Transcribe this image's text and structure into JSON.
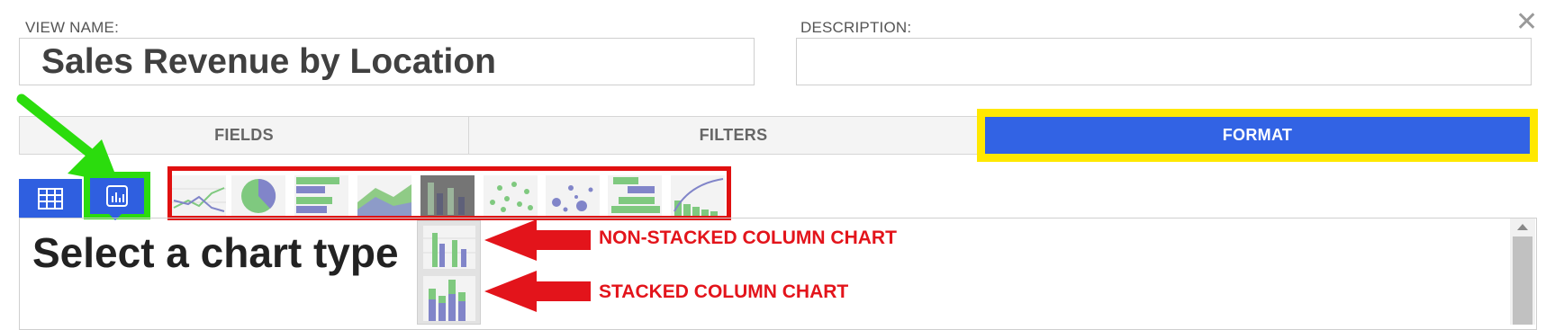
{
  "form": {
    "view_name_label": "VIEW NAME:",
    "view_name_value": "Sales Revenue by Location",
    "description_label": "DESCRIPTION:",
    "description_value": ""
  },
  "tabs": [
    {
      "label": "FIELDS"
    },
    {
      "label": "FILTERS"
    },
    {
      "label": "FORMAT"
    }
  ],
  "view_toggle": {
    "table_icon": "table-grid-icon",
    "chart_icon": "bar-chart-icon"
  },
  "chart_types": [
    "line",
    "pie",
    "horizontal-bar",
    "area",
    "column",
    "scatter",
    "bubble",
    "gantt",
    "pareto"
  ],
  "main": {
    "heading": "Select a chart type"
  },
  "column_options": [
    {
      "name": "non-stacked-column",
      "annotation": "NON-STACKED COLUMN CHART"
    },
    {
      "name": "stacked-column",
      "annotation": "STACKED COLUMN CHART"
    }
  ],
  "colors": {
    "accent_blue": "#3263e4",
    "highlight_yellow": "#ffe800",
    "annotation_red": "#e3141b",
    "arrow_green": "#2bdc0d",
    "chart_green": "#7fc97f",
    "chart_purple": "#8185c9"
  }
}
